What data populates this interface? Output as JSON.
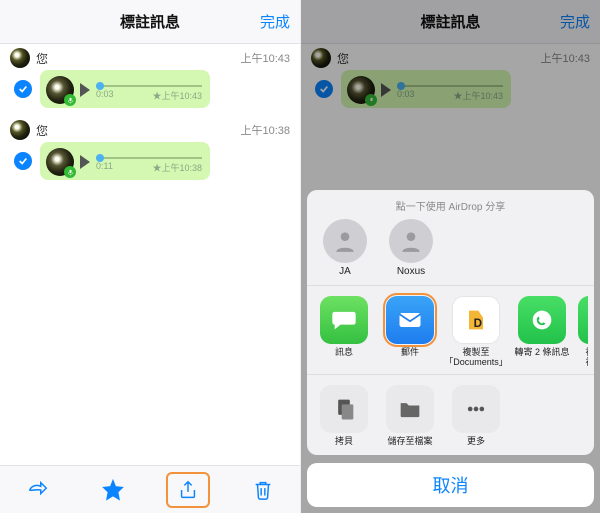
{
  "header": {
    "title": "標註訊息",
    "done": "完成"
  },
  "messages": [
    {
      "sender": "您",
      "time": "上午10:43",
      "duration": "0:03",
      "stamp": "★上午10:43"
    },
    {
      "sender": "您",
      "time": "上午10:38",
      "duration": "0:11",
      "stamp": "★上午10:38"
    }
  ],
  "share": {
    "airdrop_title": "點一下使用 AirDrop 分享",
    "people": [
      {
        "name": "JA"
      },
      {
        "name": "Noxus"
      }
    ],
    "apps": [
      {
        "label": "訊息"
      },
      {
        "label": "郵件"
      },
      {
        "label": "複製至\n「Documents」"
      },
      {
        "label": "轉寄 2 條訊息"
      },
      {
        "label": "複\n視"
      }
    ],
    "actions": [
      {
        "label": "拷貝"
      },
      {
        "label": "儲存至檔案"
      },
      {
        "label": "更多"
      }
    ],
    "cancel": "取消"
  }
}
